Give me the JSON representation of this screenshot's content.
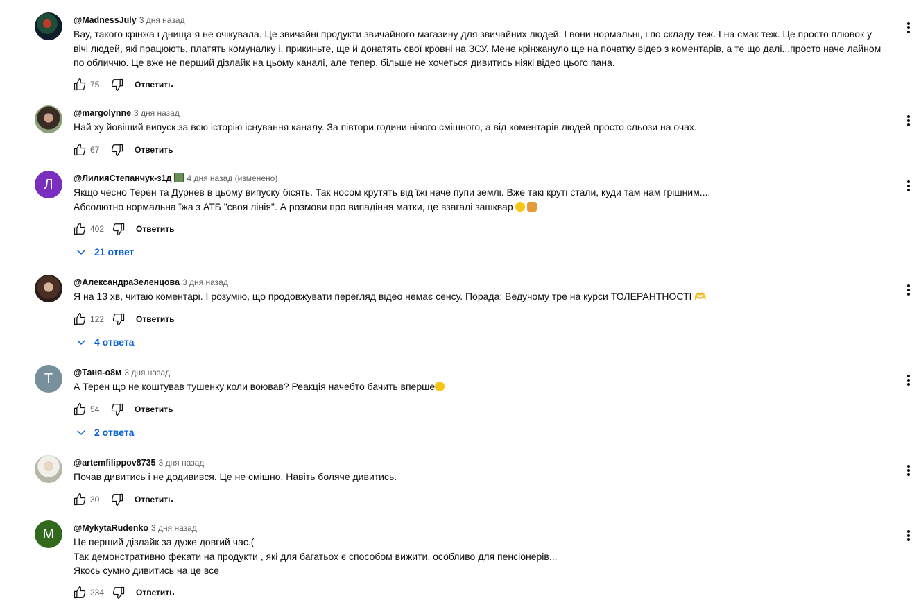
{
  "comments": [
    {
      "author": "@MadnessJuly",
      "time": "3 дня назад",
      "lines": [
        "Вау, такого крінжа і днища я не очікувала. Це звичайні продукти звичайного магазину для звичайних людей. І вони нормальні, і по складу теж. І на смак теж. Це просто плювок у",
        "вічі людей, які працюють, платять комуналку і, прикиньте, ще й донатять свої кровні на ЗСУ. Мене крінжануло ще на початку відео з коментарів, а те що далі...просто наче лайном",
        "по обличчю. Це вже не перший дізлайк на цьому каналі, але тепер, більше не хочеться дивитись ніякі відео цього пана."
      ],
      "likes": "75",
      "reply_label": "Ответить"
    },
    {
      "author": "@margolynne",
      "time": "3 дня назад",
      "lines": [
        "Най ху йовіший випуск за всю історію існування каналу. За півтори години нічого смішного, а від коментарів людей просто сльози на очах."
      ],
      "likes": "67",
      "reply_label": "Ответить"
    },
    {
      "author": "@ЛилияСтепанчук-з1д",
      "time": "4 дня назад (изменено)",
      "avatar_letter": "Л",
      "lines": [
        "Якщо чесно Терен та Дурнев в цьому випуску бісять. Так носом крутять від їжі наче пупи землі. Вже такі круті стали, куди там нам грішним....",
        "Абсолютно нормальна їжа з АТБ \"своя лінія\". А розмови про випадіння матки, це взагалі зашквар"
      ],
      "likes": "402",
      "reply_label": "Ответить",
      "replies": "21 ответ"
    },
    {
      "author": "@АлександраЗеленцова",
      "time": "3 дня назад",
      "lines": [
        "Я на 13 хв, читаю коментарі. І розумію, що продовжувати перегляд відео немає сенсу. Порада: Ведучому тре на курси ТОЛЕРАНТНОСТІ 🫶"
      ],
      "likes": "122",
      "reply_label": "Ответить",
      "replies": "4 ответа"
    },
    {
      "author": "@Таня-о8м",
      "time": "3 дня назад",
      "avatar_letter": "Т",
      "lines": [
        "А Терен що не коштував тушенку коли воював? Реакція начебто бачить вперше"
      ],
      "likes": "54",
      "reply_label": "Ответить",
      "replies": "2 ответа"
    },
    {
      "author": "@artemfilippov8735",
      "time": "3 дня назад",
      "lines": [
        "Почав дивитись і не додивився. Це не смішно. Навіть боляче дивитись."
      ],
      "likes": "30",
      "reply_label": "Ответить"
    },
    {
      "author": "@MykytaRudenko",
      "time": "3 дня назад",
      "avatar_letter": "M",
      "lines": [
        "Це перший дізлайк за дуже довгий час.(",
        "Так демонстративно фекати на продукти , які для багатьох є способом вижити, особливо для пенсіонерів...",
        "Якось сумно дивитись на це все"
      ],
      "likes": "234",
      "reply_label": "Ответить"
    }
  ],
  "colors": {
    "link": "#065fd4",
    "avatar_l": "#7b2fbf",
    "avatar_t": "#78909c",
    "avatar_m": "#33691e"
  },
  "icons": [
    "like-icon",
    "dislike-icon",
    "chevron-down-icon",
    "more-vert-icon"
  ]
}
